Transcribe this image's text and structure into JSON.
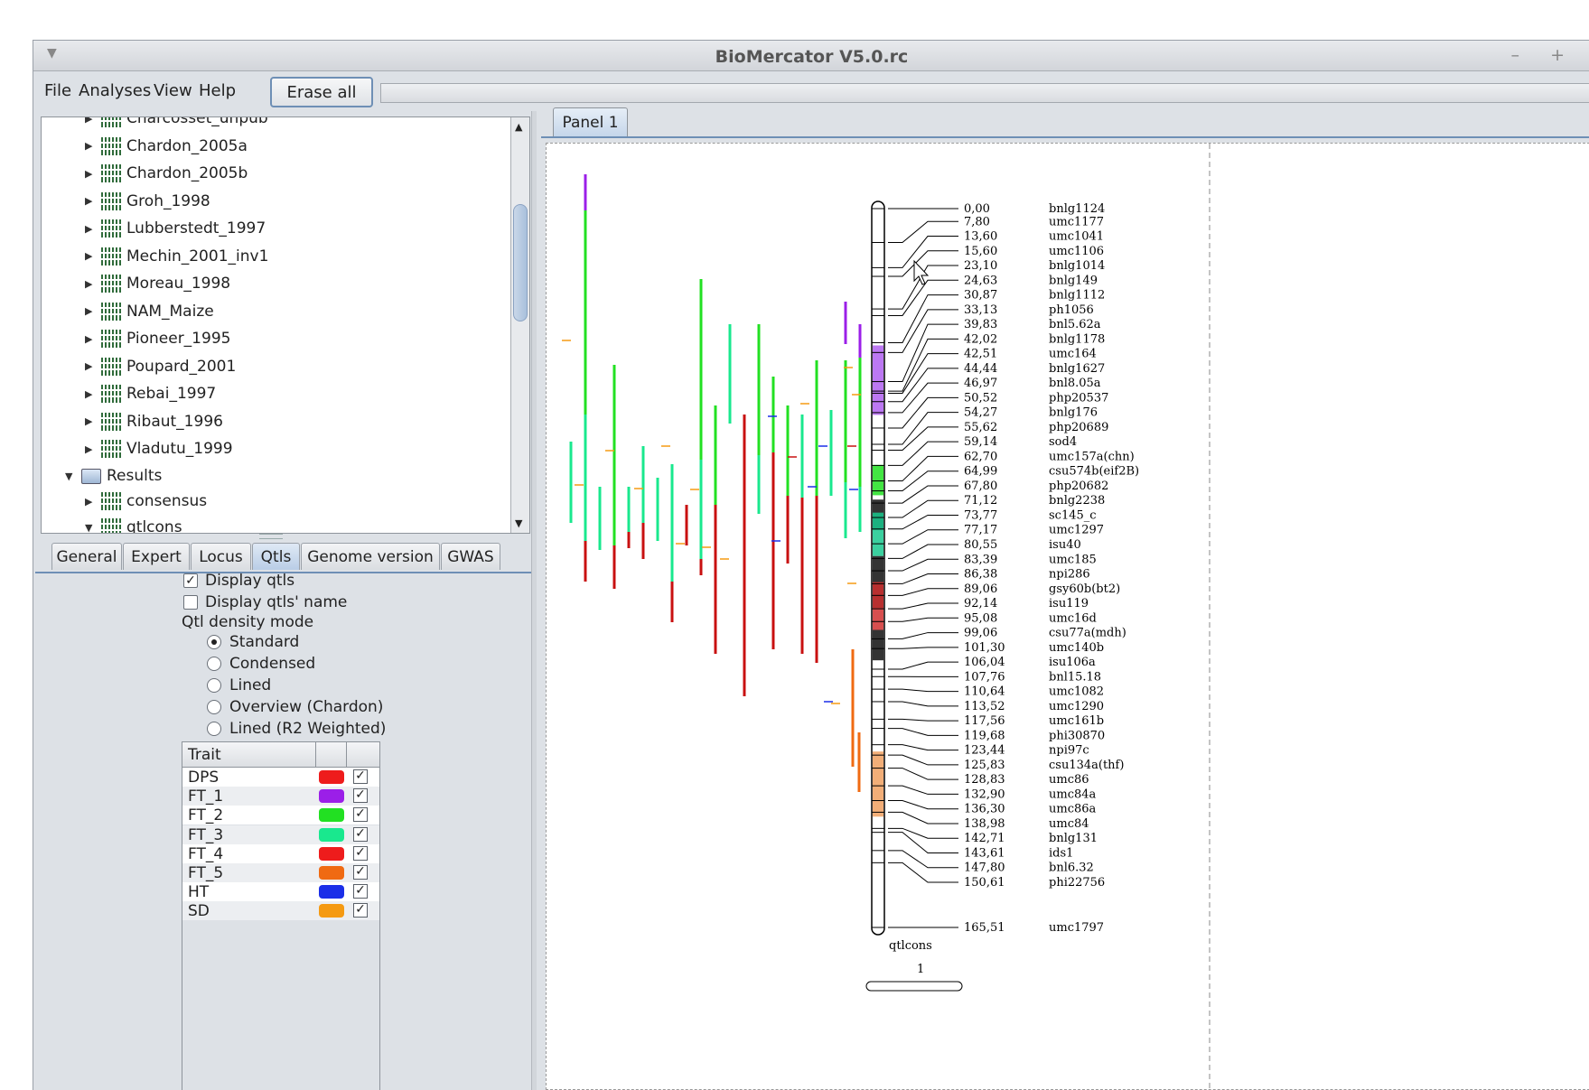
{
  "window": {
    "title": "BioMercator V5.0.rc",
    "controls": "– +"
  },
  "menubar": {
    "items": [
      "File",
      "Analyses",
      "View",
      "Help"
    ],
    "erase_label": "Erase all"
  },
  "tree": {
    "items": [
      {
        "label": "Charcosset_unpub",
        "type": "dataset"
      },
      {
        "label": "Chardon_2005a",
        "type": "dataset"
      },
      {
        "label": "Chardon_2005b",
        "type": "dataset"
      },
      {
        "label": "Groh_1998",
        "type": "dataset"
      },
      {
        "label": "Lubberstedt_1997",
        "type": "dataset"
      },
      {
        "label": "Mechin_2001_inv1",
        "type": "dataset"
      },
      {
        "label": "Moreau_1998",
        "type": "dataset"
      },
      {
        "label": "NAM_Maize",
        "type": "dataset"
      },
      {
        "label": "Pioneer_1995",
        "type": "dataset"
      },
      {
        "label": "Poupard_2001",
        "type": "dataset"
      },
      {
        "label": "Rebai_1997",
        "type": "dataset"
      },
      {
        "label": "Ribaut_1996",
        "type": "dataset"
      },
      {
        "label": "Vladutu_1999",
        "type": "dataset"
      },
      {
        "label": "Results",
        "type": "folder"
      },
      {
        "label": "consensus",
        "type": "dataset"
      },
      {
        "label": "qtlcons",
        "type": "dataset"
      }
    ]
  },
  "tabs": [
    "General",
    "Expert",
    "Locus",
    "Qtls",
    "Genome version",
    "GWAS"
  ],
  "active_tab": "Qtls",
  "qtls_options": {
    "display_qtls": "Display qtls",
    "display_qtls_name": "Display qtls' name",
    "density_mode_label": "Qtl density mode",
    "modes": [
      "Standard",
      "Condensed",
      "Lined",
      "Overview (Chardon)",
      "Lined (R2 Weighted)"
    ],
    "selected_mode": "Standard"
  },
  "trait_table": {
    "header": "Trait",
    "rows": [
      {
        "name": "DPS",
        "color": "#ee1c1c"
      },
      {
        "name": "FT_1",
        "color": "#9b1fe8"
      },
      {
        "name": "FT_2",
        "color": "#22e022"
      },
      {
        "name": "FT_3",
        "color": "#19e88e"
      },
      {
        "name": "FT_4",
        "color": "#ee1c1c"
      },
      {
        "name": "FT_5",
        "color": "#f06a12"
      },
      {
        "name": "HT",
        "color": "#1a2ee8"
      },
      {
        "name": "SD",
        "color": "#f59a12"
      }
    ]
  },
  "panel": {
    "tab_label": "Panel 1"
  },
  "chart_data": {
    "type": "genetic-map",
    "chromosome_name": "qtlcons",
    "chromosome_index": "1",
    "markers": [
      {
        "pos": "0,00",
        "name": "bnlg1124"
      },
      {
        "pos": "7,80",
        "name": "umc1177"
      },
      {
        "pos": "13,60",
        "name": "umc1041"
      },
      {
        "pos": "15,60",
        "name": "umc1106"
      },
      {
        "pos": "23,10",
        "name": "bnlg1014"
      },
      {
        "pos": "24,63",
        "name": "bnlg149"
      },
      {
        "pos": "30,87",
        "name": "bnlg1112"
      },
      {
        "pos": "33,13",
        "name": "ph1056"
      },
      {
        "pos": "39,83",
        "name": "bnl5.62a"
      },
      {
        "pos": "42,02",
        "name": "bnlg1178"
      },
      {
        "pos": "42,51",
        "name": "umc164"
      },
      {
        "pos": "44,44",
        "name": "bnlg1627"
      },
      {
        "pos": "46,97",
        "name": "bnl8.05a"
      },
      {
        "pos": "50,52",
        "name": "php20537"
      },
      {
        "pos": "54,27",
        "name": "bnlg176"
      },
      {
        "pos": "55,62",
        "name": "php20689"
      },
      {
        "pos": "59,14",
        "name": "sod4"
      },
      {
        "pos": "62,70",
        "name": "umc157a(chn)"
      },
      {
        "pos": "64,99",
        "name": "csu574b(eif2B)"
      },
      {
        "pos": "67,80",
        "name": "php20682"
      },
      {
        "pos": "71,12",
        "name": "bnlg2238"
      },
      {
        "pos": "73,77",
        "name": "sc145_c"
      },
      {
        "pos": "77,17",
        "name": "umc1297"
      },
      {
        "pos": "80,55",
        "name": "isu40"
      },
      {
        "pos": "83,39",
        "name": "umc185"
      },
      {
        "pos": "86,38",
        "name": "npi286"
      },
      {
        "pos": "89,06",
        "name": "gsy60b(bt2)"
      },
      {
        "pos": "92,14",
        "name": "isu119"
      },
      {
        "pos": "95,08",
        "name": "umc16d"
      },
      {
        "pos": "99,06",
        "name": "csu77a(mdh)"
      },
      {
        "pos": "101,30",
        "name": "umc140b"
      },
      {
        "pos": "106,04",
        "name": "isu106a"
      },
      {
        "pos": "107,76",
        "name": "bnl15.18"
      },
      {
        "pos": "110,64",
        "name": "umc1082"
      },
      {
        "pos": "113,52",
        "name": "umc1290"
      },
      {
        "pos": "117,56",
        "name": "umc161b"
      },
      {
        "pos": "119,68",
        "name": "phi30870"
      },
      {
        "pos": "123,44",
        "name": "npi97c"
      },
      {
        "pos": "125,83",
        "name": "csu134a(thf)"
      },
      {
        "pos": "128,83",
        "name": "umc86"
      },
      {
        "pos": "132,90",
        "name": "umc84a"
      },
      {
        "pos": "136,30",
        "name": "umc86a"
      },
      {
        "pos": "138,98",
        "name": "umc84"
      },
      {
        "pos": "142,71",
        "name": "bnlg131"
      },
      {
        "pos": "143,61",
        "name": "ids1"
      },
      {
        "pos": "147,80",
        "name": "bnl6.32"
      },
      {
        "pos": "150,61",
        "name": "phi22756"
      },
      {
        "pos": "165,51",
        "name": "umc1797"
      }
    ],
    "qtl_colors": {
      "FT_1": "#9b1fe8",
      "FT_2": "#22e022",
      "FT_3": "#19e88e",
      "DPS": "#c81010",
      "FT_5": "#f06a12",
      "SD": "#f59a12",
      "HT": "#1a2ee8"
    }
  }
}
